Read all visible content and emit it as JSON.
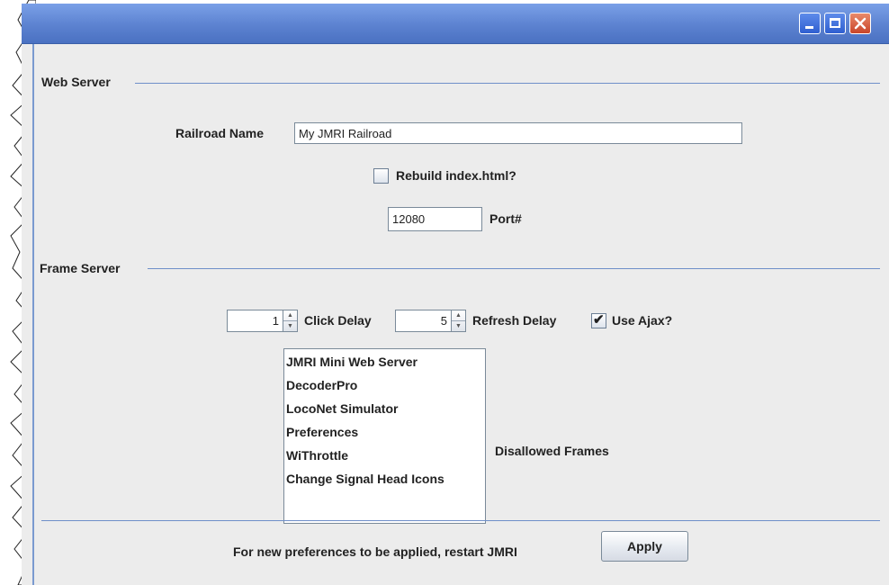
{
  "window": {
    "controls": [
      "minimize",
      "maximize",
      "close"
    ]
  },
  "web_server": {
    "section_title": "Web Server",
    "railroad_name_label": "Railroad Name",
    "railroad_name_value": "My JMRI Railroad",
    "rebuild_label": "Rebuild index.html?",
    "rebuild_checked": false,
    "port_value": "12080",
    "port_label": "Port#"
  },
  "frame_server": {
    "section_title": "Frame Server",
    "click_delay_value": "1",
    "click_delay_label": "Click Delay",
    "refresh_delay_value": "5",
    "refresh_delay_label": "Refresh Delay",
    "use_ajax_label": "Use Ajax?",
    "use_ajax_checked": true,
    "frames": [
      "JMRI Mini Web Server",
      "DecoderPro",
      "LocoNet Simulator",
      "Preferences",
      "WiThrottle",
      "Change Signal Head Icons"
    ],
    "disallowed_label": "Disallowed Frames"
  },
  "footer": {
    "restart_note": "For new preferences to be applied, restart JMRI",
    "apply_label": "Apply"
  },
  "colors": {
    "titlebar": "#5c82d0",
    "separator": "#6f8fc9",
    "panel": "#ececec"
  },
  "icons": {
    "minimize": "minimize-icon",
    "maximize": "maximize-icon",
    "close": "close-icon",
    "spinner_up": "spinner-up-arrow-icon",
    "spinner_down": "spinner-down-arrow-icon",
    "checkmark": "checkmark-icon"
  }
}
